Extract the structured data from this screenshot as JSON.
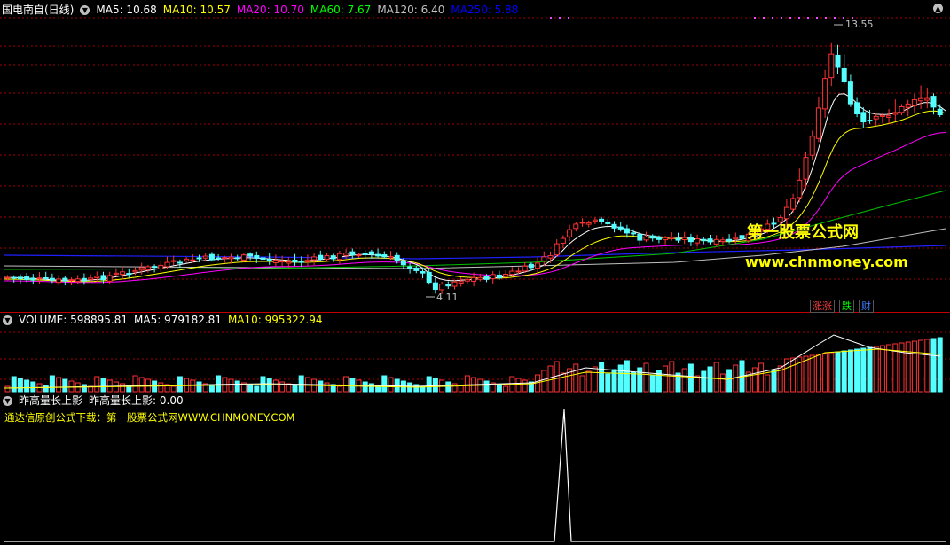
{
  "main_panel": {
    "stock_label": "国电南自(日线)",
    "indicators": [
      {
        "label": "MA5: 10.68",
        "color": "#ffffff"
      },
      {
        "label": "MA10: 10.57",
        "color": "#ffff00"
      },
      {
        "label": "MA20: 10.70",
        "color": "#ff00ff"
      },
      {
        "label": "MA60: 7.67",
        "color": "#00ff00"
      },
      {
        "label": "MA120: 6.40",
        "color": "#c0c0c0"
      },
      {
        "label": "MA250: 5.88",
        "color": "#0000ff"
      }
    ],
    "high_label": "13.55",
    "low_label": "4.11",
    "watermark_cn": "第一股票公式网",
    "watermark_url": "www.chnmoney.com",
    "badges": [
      {
        "label": "涨涨",
        "color": "#ff4040"
      },
      {
        "label": "跌",
        "color": "#00ff00"
      },
      {
        "label": "财",
        "color": "#4080ff"
      }
    ]
  },
  "volume_panel": {
    "indicators": [
      {
        "label": "VOLUME: 598895.81",
        "color": "#ffffff"
      },
      {
        "label": "MA5: 979182.81",
        "color": "#ffffff"
      },
      {
        "label": "MA10: 995322.94",
        "color": "#ffff00"
      }
    ]
  },
  "formula_panel": {
    "indicators": [
      {
        "label": "昨高量长上影",
        "color": "#ffffff"
      },
      {
        "label": "昨高量长上影: 0.00",
        "color": "#ffffff"
      }
    ],
    "promo_text": "通达信原创公式下载：第一股票公式网WWW.CHNMONEY.COM"
  },
  "colors": {
    "up": "#ff3232",
    "down": "#54ffff",
    "grid": "#a00000",
    "background": "#000000"
  },
  "chart_data": {
    "type": "candlestick",
    "title": "国电南自(日线)",
    "price_high": 13.55,
    "price_low": 4.11,
    "ma_latest": {
      "MA5": 10.68,
      "MA10": 10.57,
      "MA20": 10.7,
      "MA60": 7.67,
      "MA120": 6.4,
      "MA250": 5.88
    },
    "volume_latest": {
      "VOLUME": 598895.81,
      "MA5": 979182.81,
      "MA10": 995322.94
    },
    "formula_latest": 0.0
  }
}
